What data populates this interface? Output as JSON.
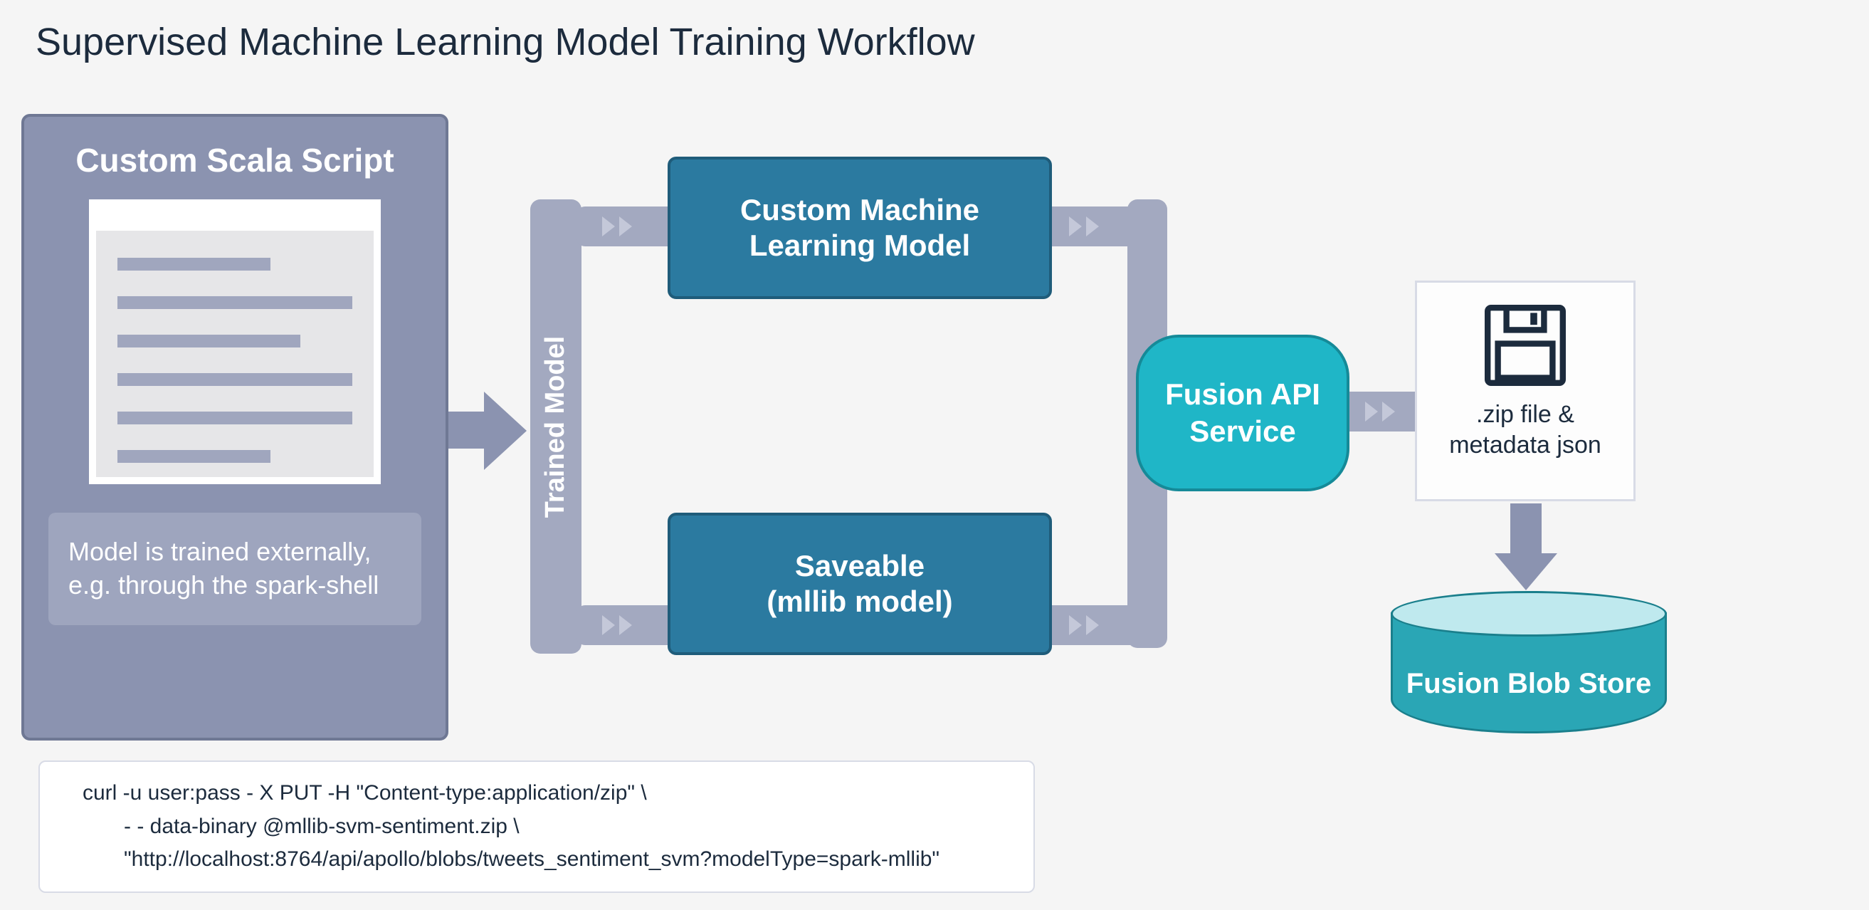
{
  "title": "Supervised Machine Learning Model Training Workflow",
  "scala_panel": {
    "title": "Custom Scala Script",
    "caption": "Model is trained externally, e.g. through the spark-shell"
  },
  "trained_model_label": "Trained Model",
  "boxes": {
    "custom_ml": "Custom Machine\nLearning Model",
    "saveable": "Saveable\n(mllib model)",
    "api_service": "Fusion API\nService"
  },
  "zip_card": {
    "label": ".zip file &\nmetadata json"
  },
  "store": {
    "label": "Fusion Blob Store"
  },
  "curl": {
    "line1": "curl -u user:pass - X PUT -H \"Content-type:application/zip\"   \\",
    "line2": "- - data-binary  @mllib-svm-sentiment.zip \\",
    "line3": "\"http://localhost:8764/api/apollo/blobs/tweets_sentiment_svm?modelType=spark-mllib\""
  },
  "colors": {
    "panel_fill": "#8b93b0",
    "panel_border": "#6f7894",
    "pipe": "#a3a9c0",
    "model_fill": "#2b7aa0",
    "model_border": "#1f5c7a",
    "api_fill": "#1fb6c7",
    "api_border": "#158a98",
    "store_fill": "#2aa6b5",
    "text_dark": "#1c2b3d"
  }
}
